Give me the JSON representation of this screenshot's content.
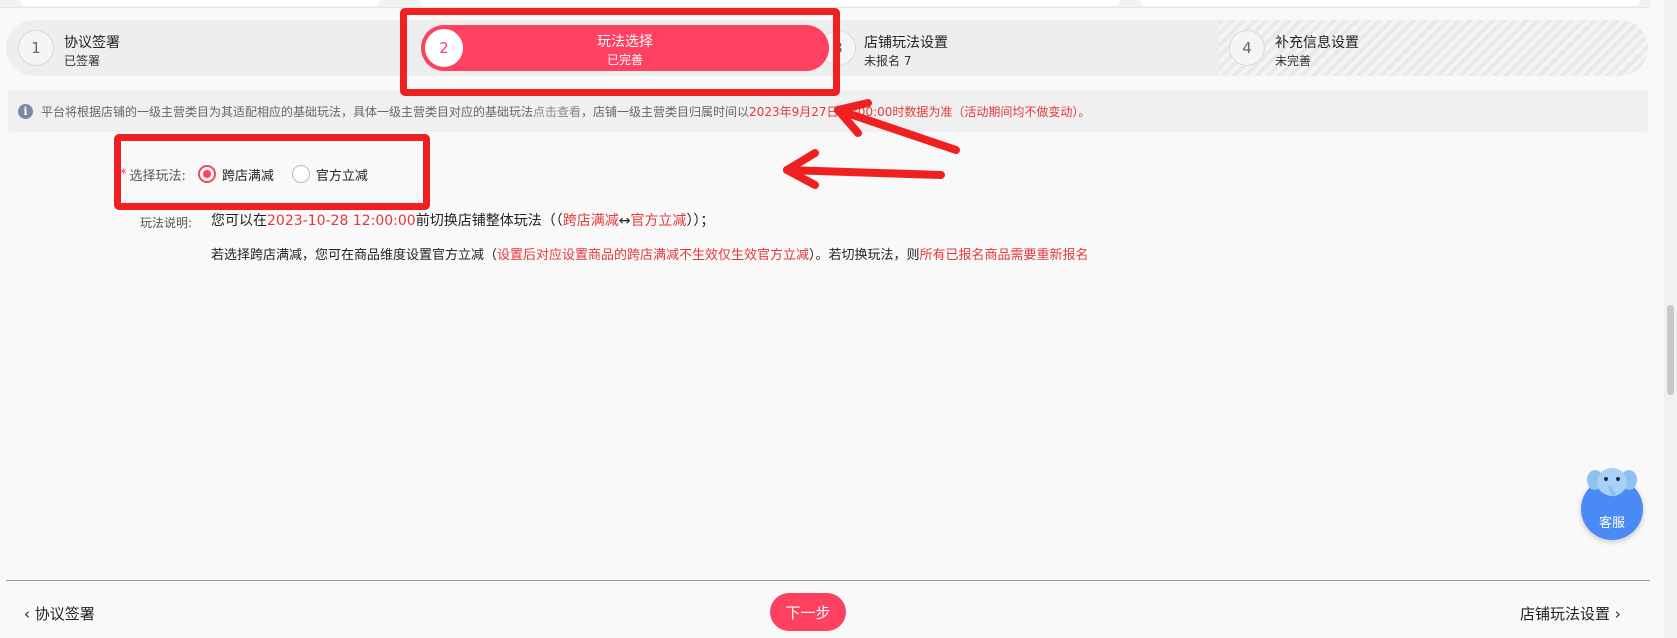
{
  "steps": [
    {
      "number": "1",
      "title": "协议签署",
      "status": "已签署"
    },
    {
      "number": "2",
      "title": "玩法选择",
      "status": "已完善"
    },
    {
      "number": "3",
      "title": "店铺玩法设置",
      "status": "未报名 7"
    },
    {
      "number": "4",
      "title": "补充信息设置",
      "status": "未完善"
    }
  ],
  "notice": {
    "icon": "info-icon",
    "text_before": "平台将根据店铺的一级主营类目为其适配相应的基础玩法，具体一级主营类目对应的基础玩法",
    "link": "点击查看",
    "text_middle": "，店铺一级主营类目归属时间以",
    "highlight": "2023年9月27日00:00:00时数据为准（活动期间均不做变动）。"
  },
  "form": {
    "required_mark": "*",
    "label": "选择玩法:",
    "options": [
      {
        "label": "跨店满减",
        "checked": true
      },
      {
        "label": "官方立减",
        "checked": false
      }
    ]
  },
  "description": {
    "label": "玩法说明:",
    "line1_a": "您可以在",
    "line1_date": "2023-10-28 12:00:00",
    "line1_b": "前切换店铺整体玩法（（",
    "line1_red1": "跨店满减",
    "line1_arrow": "↔",
    "line1_red2": "官方立减",
    "line1_c": "））；",
    "line2_a": "若选择跨店满减，您可在商品维度设置官方立减（",
    "line2_red1": "设置后对应设置商品的跨店满减不生效仅生效官方立减",
    "line2_b": "）。若切换玩法，则",
    "line2_red2": "所有已报名商品需要重新报名"
  },
  "customer_service": {
    "label": "客服"
  },
  "footer": {
    "prev_label": "协议签署",
    "next_button": "下一步",
    "next_step_label": "店铺玩法设置"
  },
  "colors": {
    "accent": "#ff4060",
    "annotation": "#f02020",
    "cs_blue": "#4a8af4"
  }
}
